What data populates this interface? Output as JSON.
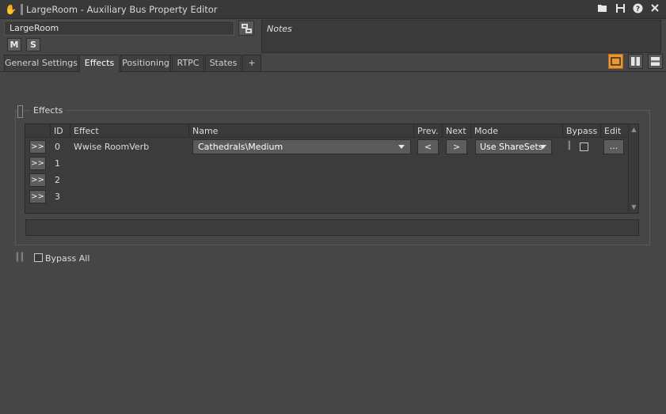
{
  "window": {
    "title": "LargeRoom - Auxiliary Bus Property Editor",
    "icons": [
      "bus-icon",
      "folder-icon",
      "save-icon",
      "help-icon",
      "close-icon"
    ]
  },
  "object": {
    "name": "LargeRoom",
    "mute_label": "M",
    "solo_label": "S",
    "notes_placeholder": "Notes"
  },
  "tabs": [
    {
      "label": "General Settings",
      "active": false
    },
    {
      "label": "Effects",
      "active": true
    },
    {
      "label": "Positioning",
      "active": false
    },
    {
      "label": "RTPC",
      "active": false
    },
    {
      "label": "States",
      "active": false
    },
    {
      "label": "+",
      "active": false
    }
  ],
  "layout_buttons": [
    "single-pane-icon",
    "two-column-icon",
    "two-row-icon"
  ],
  "accent_color": "#e8983c",
  "effects_group": {
    "title": "Effects",
    "columns": [
      "ID",
      "Effect",
      "Name",
      "Prev.",
      "Next",
      "Mode",
      "Bypass",
      "Edit"
    ],
    "rows": [
      {
        "button": ">>",
        "id": "0",
        "effect": "Wwise RoomVerb",
        "name": "Cathedrals\\Medium",
        "prev": "<",
        "next": ">",
        "mode": "Use ShareSets",
        "bypass": false,
        "edit": "..."
      },
      {
        "button": ">>",
        "id": "1"
      },
      {
        "button": ">>",
        "id": "2"
      },
      {
        "button": ">>",
        "id": "3"
      }
    ]
  },
  "bypass_all": {
    "label": "Bypass All",
    "checked": false
  }
}
